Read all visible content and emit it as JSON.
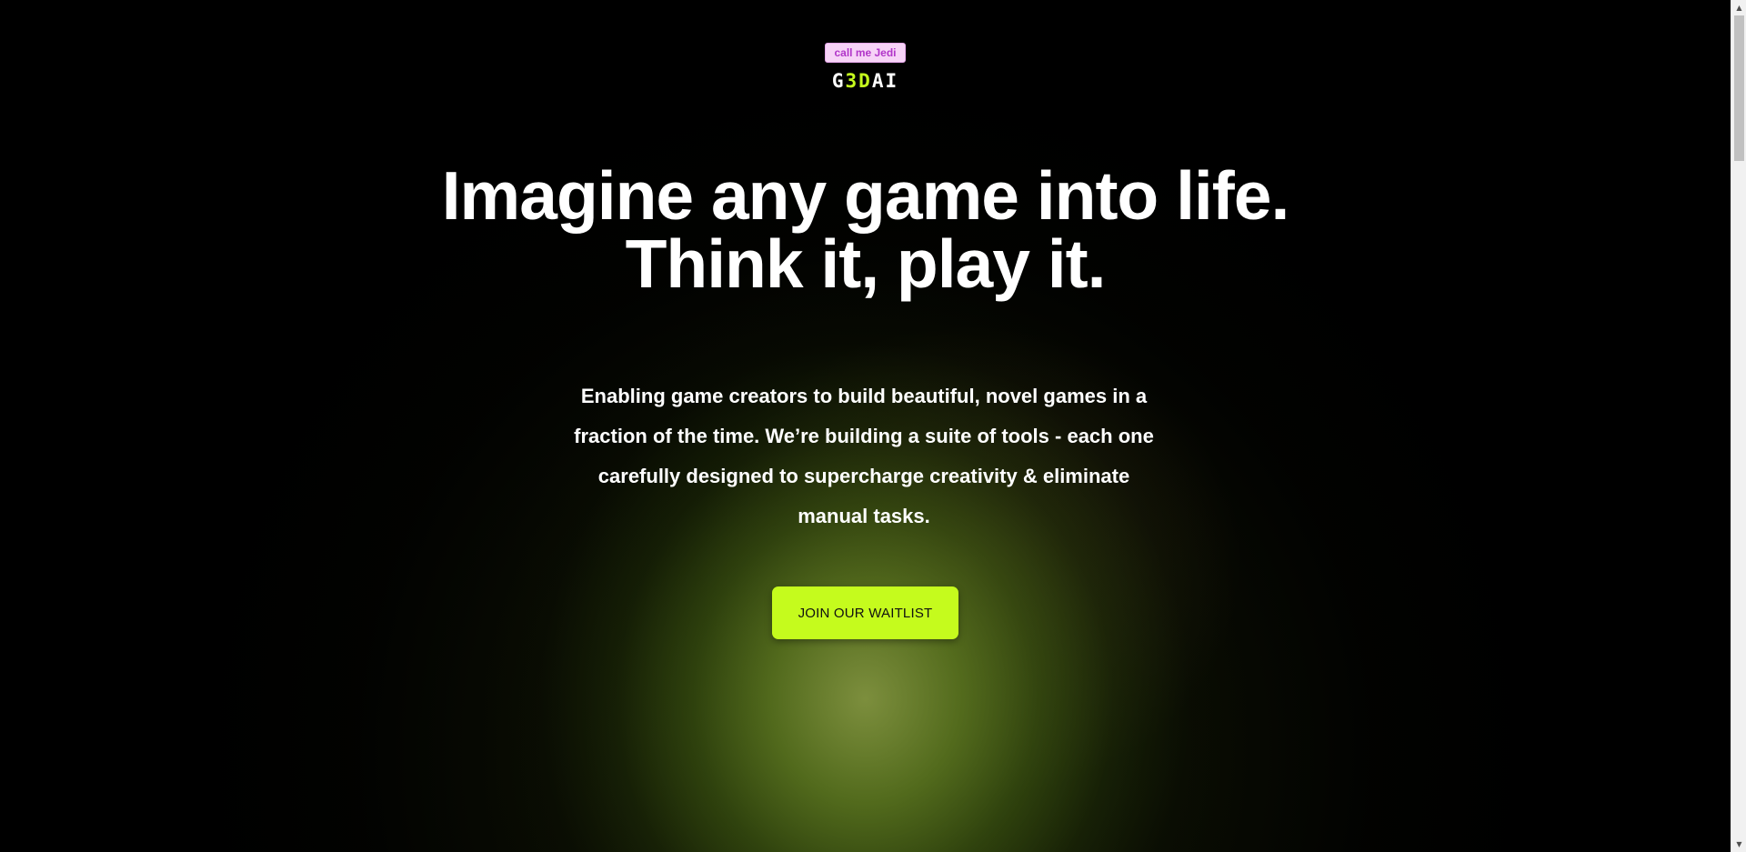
{
  "header": {
    "badge": "call me Jedi",
    "logo": {
      "part1": "G",
      "accent": "3D",
      "part2": "AI"
    }
  },
  "hero": {
    "headline_line1": "Imagine any game into life.",
    "headline_line2": "Think it, play it.",
    "description": "Enabling game creators to build beautiful, novel games in a fraction of the time. We’re building a suite of tools - each one carefully designed to supercharge creativity & eliminate manual tasks.",
    "cta_label": "JOIN OUR WAITLIST"
  },
  "scrollbar": {
    "up_icon": "▲",
    "down_icon": "▼"
  },
  "colors": {
    "background": "#000000",
    "accent": "#c5fb1d",
    "badge_bg": "#f7d3f7",
    "badge_text": "#b136c9"
  }
}
